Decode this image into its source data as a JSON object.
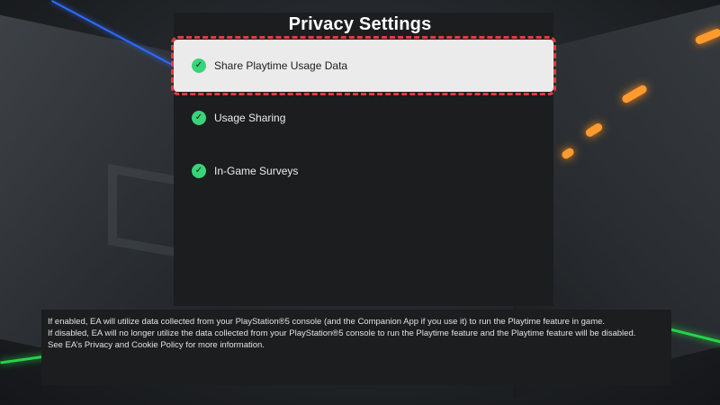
{
  "page": {
    "title": "Privacy Settings"
  },
  "options": [
    {
      "label": "Share Playtime Usage Data",
      "checked": true,
      "focused": true
    },
    {
      "label": "Usage Sharing",
      "checked": true,
      "focused": false
    },
    {
      "label": "In-Game Surveys",
      "checked": true,
      "focused": false
    }
  ],
  "description": {
    "line1": "If enabled, EA will utilize data collected from your PlayStation®5 console (and the Companion App if you use it) to run the Playtime feature in game.",
    "line2": "If disabled, EA will no longer utilize the data collected from your PlayStation®5 console to run the Playtime feature and the Playtime feature will be disabled.",
    "line3": "See EA’s Privacy and Cookie Policy for more information."
  },
  "icons": {
    "check": "checkmark-circle-icon"
  },
  "colors": {
    "check_green": "#3ad37a",
    "focus_outline": "#e33a3f",
    "focused_bg": "#ebebeb",
    "panel_bg": "#1b1d1f"
  }
}
